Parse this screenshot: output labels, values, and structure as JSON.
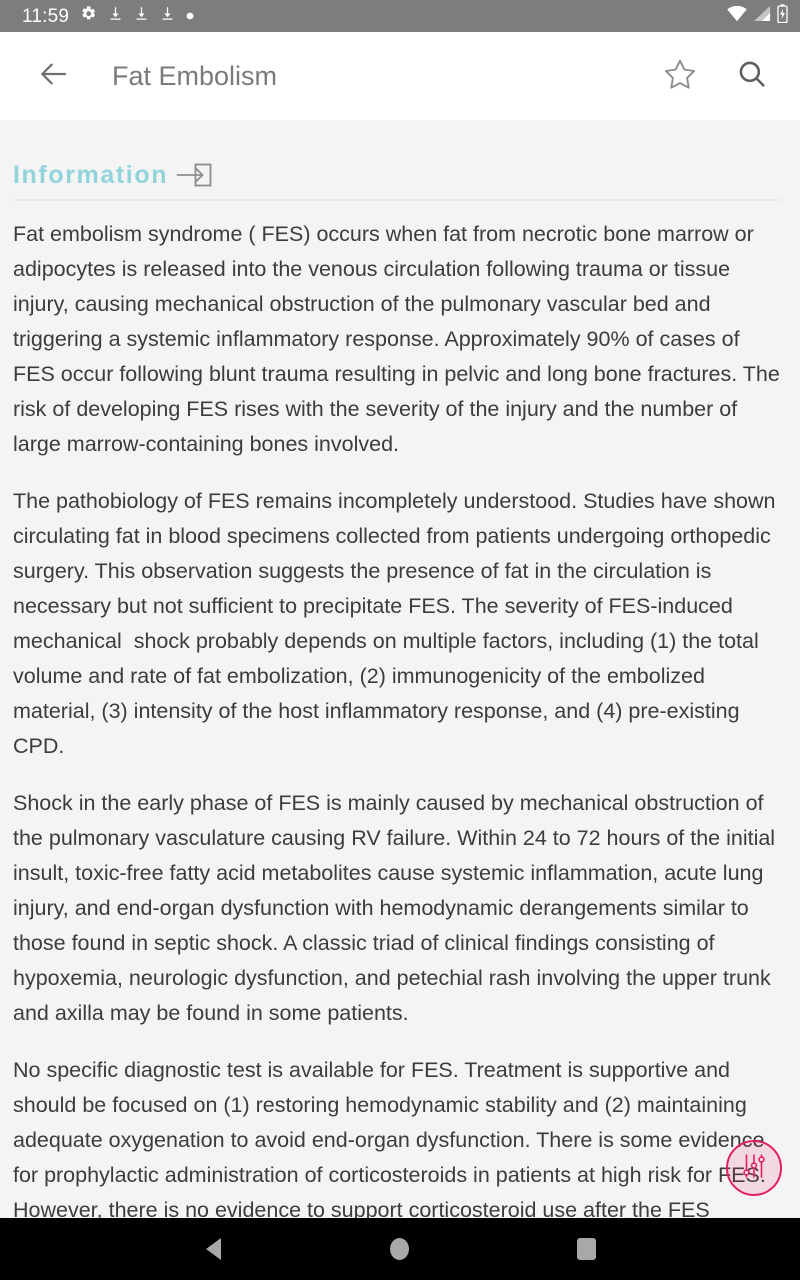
{
  "status_bar": {
    "time": "11:59",
    "left_icons": [
      "gear-icon",
      "download-icon",
      "download-icon",
      "download-icon",
      "dot-icon"
    ],
    "right_icons": [
      "wifi-icon",
      "signal-icon",
      "battery-charging-icon"
    ],
    "background_color": "#7d7d7d",
    "icon_color": "#ffffff"
  },
  "app_bar": {
    "back_label": "back-arrow",
    "title": "Fat Embolism",
    "actions": [
      {
        "name": "favorite-star-icon",
        "label": "Favorite"
      },
      {
        "name": "search-icon",
        "label": "Search"
      }
    ],
    "background_color": "#ffffff",
    "title_color": "#7a7a7a"
  },
  "section": {
    "title": "Information",
    "icon": "arrow-into-box-icon",
    "title_color": "#92d4dc",
    "rule_color": "#e2eeee"
  },
  "article": {
    "paragraphs": [
      "Fat embolism syndrome ( FES) occurs when fat from necrotic bone marrow or adipocytes is released into the venous circulation following trauma or tissue injury, causing mechanical obstruction of the pulmonary vascular bed and triggering a systemic inflammatory response. Approximately 90% of cases of FES occur following blunt trauma resulting in pelvic and long bone fractures. The risk of developing FES rises with the severity of the injury and the number of large marrow-containing bones involved.",
      "The pathobiology of FES remains incompletely understood. Studies have shown circulating fat in blood specimens collected from patients undergoing orthopedic surgery. This observation suggests the presence of fat in the circulation is necessary but not sufficient to precipitate FES. The severity of FES-induced mechanical  shock probably depends on multiple factors, including (1) the total volume and rate of fat embolization, (2) immunogenicity of the embolized material, (3) intensity of the host inflammatory response, and (4) pre-existing CPD.",
      "Shock in the early phase of FES is mainly caused by mechanical obstruction of the pulmonary vasculature causing RV failure. Within 24 to 72 hours of the initial insult, toxic-free fatty acid metabolites cause systemic inflammation, acute lung injury, and end-organ dysfunction with hemodynamic derangements similar to those found in septic shock. A classic triad of clinical findings consisting of hypoxemia, neurologic dysfunction, and petechial rash involving the upper trunk and axilla may be found in some patients.",
      "No specific diagnostic test is available for FES. Treatment is supportive and should be focused on (1) restoring hemodynamic stability and (2) maintaining adequate oxygenation to avoid end-organ dysfunction. There is some evidence for prophylactic administration of corticosteroids in patients at high risk for FES. However, there is no evidence to support corticosteroid use after the FES"
    ],
    "text_color": "#3c3c3c",
    "background_color": "#f4f4f4"
  },
  "fab": {
    "icon": "tune-sliders-icon",
    "border_color": "#e0225c",
    "fill_color": "rgba(233,30,99,0.13)"
  },
  "nav_bar": {
    "buttons": [
      {
        "name": "nav-back-button",
        "label": "Back"
      },
      {
        "name": "nav-home-button",
        "label": "Home"
      },
      {
        "name": "nav-recents-button",
        "label": "Recents"
      }
    ],
    "background_color": "#000000",
    "icon_color": "#a8a8a8"
  }
}
